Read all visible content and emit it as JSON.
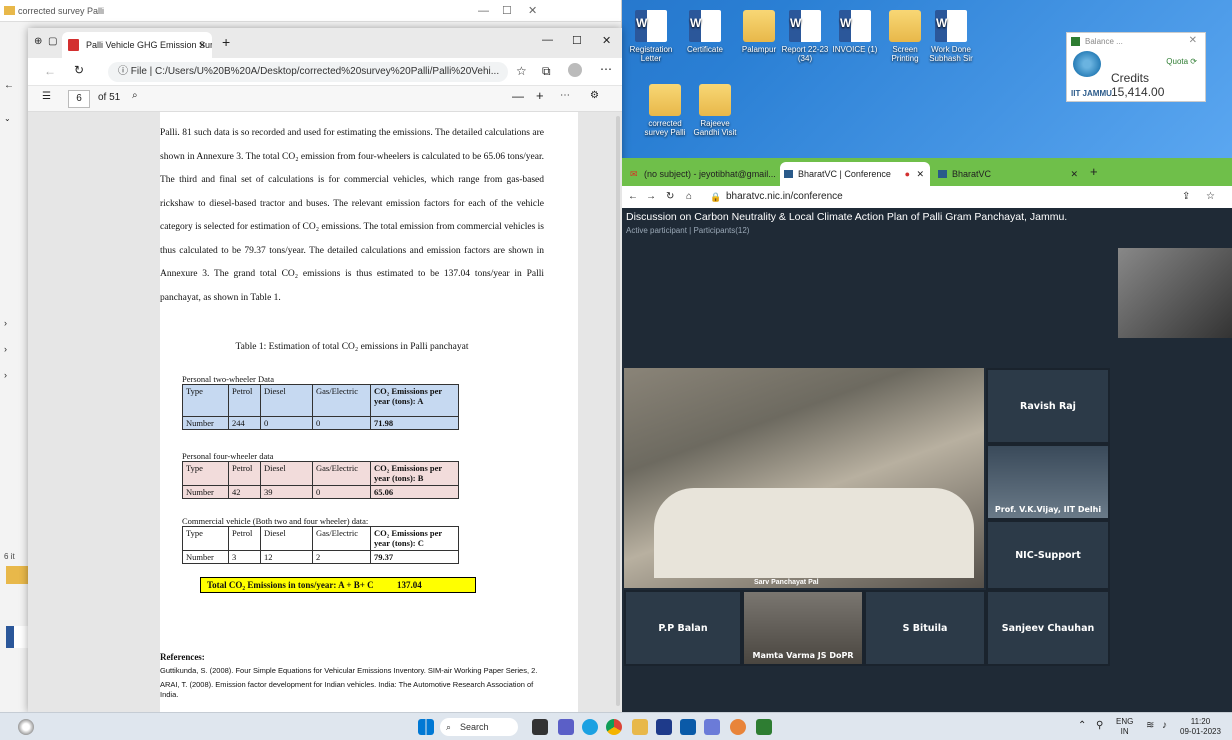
{
  "desktop": {
    "icons": [
      {
        "label": "Registration Letter"
      },
      {
        "label": "Certificate"
      },
      {
        "label": "Palampur"
      },
      {
        "label": "Report 22-23 (34)"
      },
      {
        "label": "INVOICE (1)"
      },
      {
        "label": "Screen Printing"
      },
      {
        "label": "Work Done Subhash Sir"
      },
      {
        "label": "corrected survey Palli"
      },
      {
        "label": "Rajeeve Gandhi Visit"
      }
    ],
    "side_count": "6 it"
  },
  "explorer": {
    "title": "corrected survey Palli"
  },
  "edge": {
    "tab_title": "Palli Vehicle GHG Emission Surve",
    "address": "File  |  C:/Users/U%20B%20A/Desktop/corrected%20survey%20Palli/Palli%20Vehi...",
    "page_current": "6",
    "page_total": "of 51"
  },
  "doc": {
    "paragraph": "Palli. 81 such data is so recorded and used for estimating the emissions. The detailed calculations are shown in Annexure 3. The total CO₂ emission from four-wheelers is calculated to be 65.06 tons/year. The third and final set of calculations is for commercial vehicles, which range from gas-based rickshaw to diesel-based tractor and buses. The relevant emission factors for each of the vehicle category is selected for estimation of CO₂ emissions. The total emission from commercial vehicles is thus calculated to be 79.37 tons/year. The detailed calculations and emission factors are shown in Annexure 3. The grand total CO₂ emissions is thus estimated to be 137.04 tons/year in Palli panchayat, as shown in Table 1.",
    "table_caption": "Table 1: Estimation of total CO₂ emissions in Palli panchayat",
    "tables": [
      {
        "label": "Personal two-wheeler Data",
        "headers": [
          "Type",
          "Petrol",
          "Diesel",
          "Gas/Electric",
          "CO₂ Emissions per year (tons): A"
        ],
        "row": [
          "Number",
          "244",
          "0",
          "0",
          "71.98"
        ]
      },
      {
        "label": "Personal four-wheeler data",
        "headers": [
          "Type",
          "Petrol",
          "Diesel",
          "Gas/Electric",
          "CO₂ Emissions per year (tons): B"
        ],
        "row": [
          "Number",
          "42",
          "39",
          "0",
          "65.06"
        ]
      },
      {
        "label": "Commercial vehicle (Both two and four wheeler) data:",
        "headers": [
          "Type",
          "Petrol",
          "Diesel",
          "Gas/Electric",
          "CO₂ Emissions per year (tons): C"
        ],
        "row": [
          "Number",
          "3",
          "12",
          "2",
          "79.37"
        ]
      }
    ],
    "total_label": "Total CO₂ Emissions in tons/year: A + B+ C",
    "total_value": "137.04",
    "refs_heading": "References:",
    "refs": [
      "Guttikunda, S. (2008). Four Simple Equations for Vehicular Emissions Inventory. SIM-air Working Paper Series, 2.",
      "ARAI, T. (2008). Emission factor development for Indian vehicles. India: The Automotive Research Association of India."
    ]
  },
  "browser": {
    "tabs": [
      "(no subject) - jeyotibhat@gmail...",
      "BharatVC | Conference",
      "BharatVC"
    ],
    "address": "bharatvc.nic.in/conference",
    "conf_title": "Discussion on Carbon Neutrality & Local Climate Action Plan of Palli Gram Panchayat, Jammu.",
    "conf_sub": "Active participant  |  Participants(12)",
    "main_caption": "Sarv Panchayat Pal",
    "participants": [
      "Ravish Raj",
      "Prof. V.K.Vijay, IIT Delhi",
      "NIC-Support",
      "P.P Balan",
      "Mamta Varma JS DoPR",
      "S Bituila",
      "Sanjeev Chauhan"
    ]
  },
  "balance": {
    "title": "Balance ...",
    "quota": "Quota",
    "credits": "Credits 15,414.00",
    "org": "IIT JAMMU"
  },
  "taskbar": {
    "search": "Search",
    "lang": "ENG",
    "region": "IN",
    "time": "11:20",
    "date": "09-01-2023"
  }
}
